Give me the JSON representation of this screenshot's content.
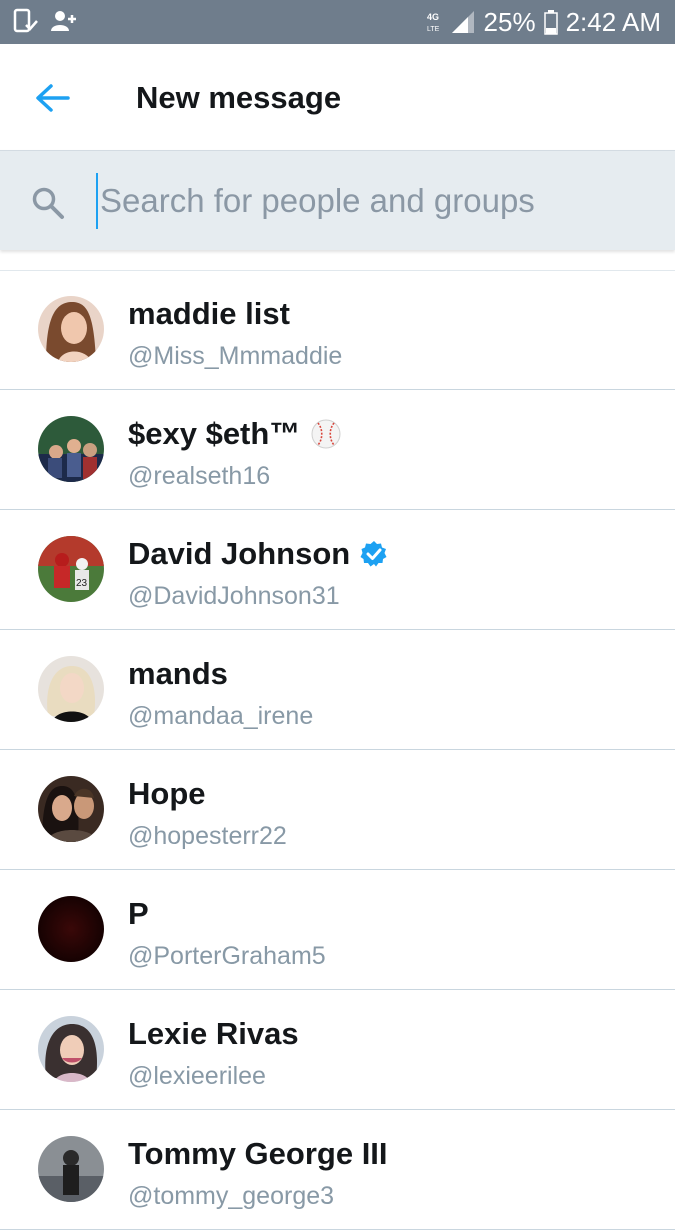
{
  "status_bar": {
    "battery": "25%",
    "time": "2:42 AM",
    "network": "4G LTE",
    "icons": [
      "device-check-icon",
      "add-contact-icon",
      "network-icon",
      "signal-icon",
      "battery-icon"
    ]
  },
  "header": {
    "title": "New message",
    "back_icon": "back-arrow-icon"
  },
  "search": {
    "placeholder": "Search for people and groups",
    "value": "",
    "icon": "search-icon"
  },
  "accent_color": "#1da1f2",
  "contacts": [
    {
      "name": "maddie list",
      "handle": "@Miss_Mmmaddie",
      "badge": ""
    },
    {
      "name": "$exy $eth™",
      "handle": "@realseth16",
      "badge": "baseball-emoji"
    },
    {
      "name": "David Johnson",
      "handle": "@DavidJohnson31",
      "badge": "verified-badge"
    },
    {
      "name": "mands",
      "handle": "@mandaa_irene",
      "badge": ""
    },
    {
      "name": "Hope",
      "handle": "@hopesterr22",
      "badge": ""
    },
    {
      "name": "P",
      "handle": "@PorterGraham5",
      "badge": ""
    },
    {
      "name": "Lexie Rivas",
      "handle": "@lexieerilee",
      "badge": ""
    },
    {
      "name": "Tommy George III",
      "handle": "@tommy_george3",
      "badge": ""
    }
  ]
}
